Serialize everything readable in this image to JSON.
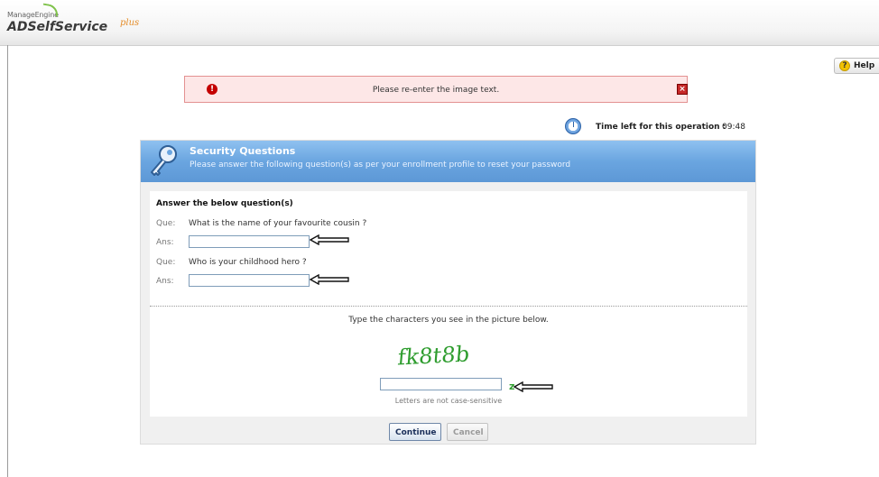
{
  "brand": {
    "company": "ManageEngine",
    "product": "ADSelfService",
    "edition": "plus"
  },
  "help": {
    "label": "Help",
    "icon": "help-icon"
  },
  "error": {
    "message": "Please re-enter the image text.",
    "icon": "error-icon",
    "close_icon": "close-icon"
  },
  "timer": {
    "label": "Time left for this operation :",
    "value": "09:48",
    "icon": "clock-icon"
  },
  "panel": {
    "title": "Security Questions",
    "subtitle": "Please answer the following question(s) as per your enrollment profile to reset your password",
    "icon": "key-icon"
  },
  "form": {
    "section_title": "Answer the below question(s)",
    "que_label": "Que:",
    "ans_label": "Ans:",
    "questions": [
      {
        "text": "What is the name of your favourite cousin ?",
        "answer": ""
      },
      {
        "text": "Who is your childhood hero ?",
        "answer": ""
      }
    ]
  },
  "captcha": {
    "prompt": "Type the characters you see in the picture below.",
    "image_text": "fk8t8b",
    "value": "",
    "note": "Letters are not case-sensitive",
    "refresh_icon": "refresh-icon"
  },
  "buttons": {
    "continue": "Continue",
    "cancel": "Cancel"
  },
  "colors": {
    "header_blue": "#6aa5e0",
    "error_bg": "#fde7e7",
    "error_border": "#e39191",
    "captcha_green": "#2f9d2f"
  }
}
